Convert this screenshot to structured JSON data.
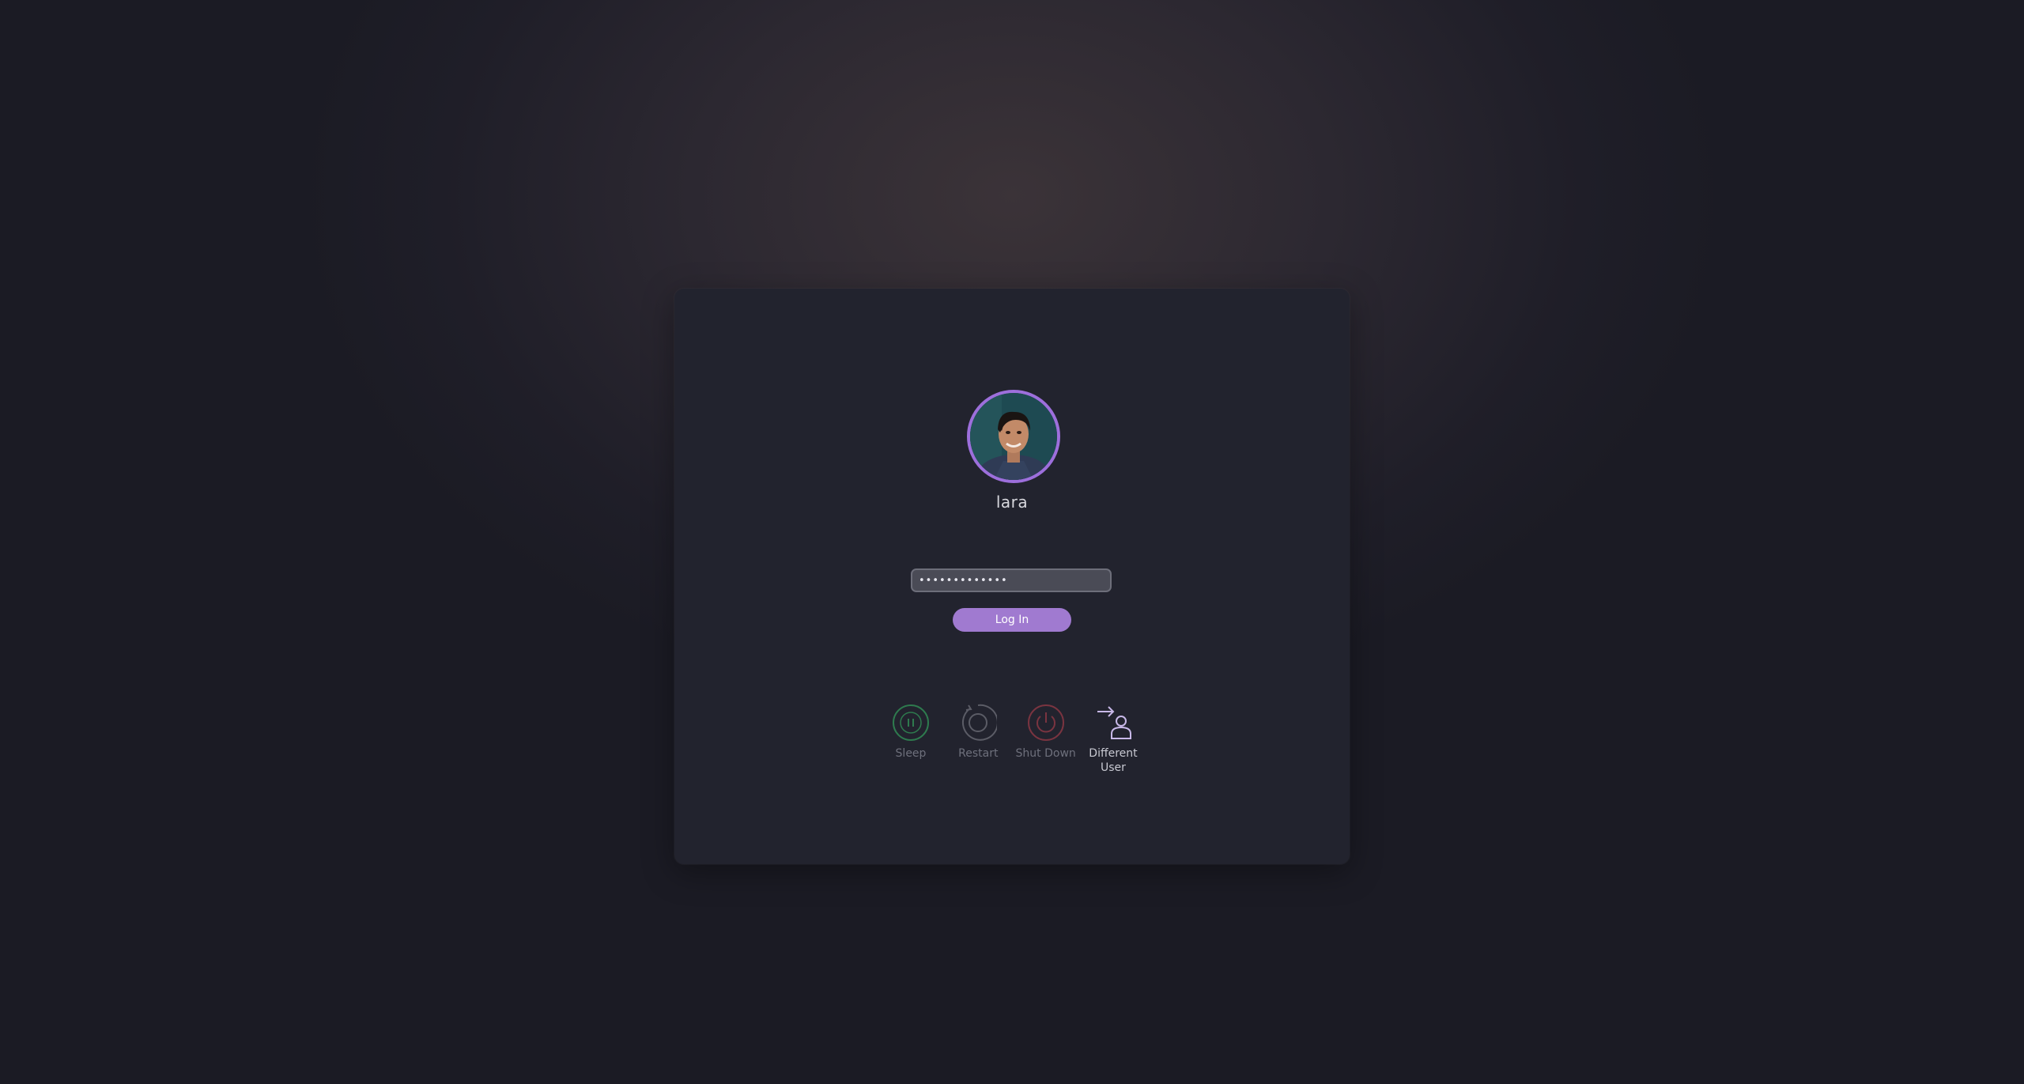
{
  "user": {
    "name": "lara"
  },
  "login": {
    "password_masked": "●●●●●●●●●●●●●",
    "button_label": "Log In"
  },
  "actions": [
    {
      "label": "Sleep",
      "icon": "sleep-icon",
      "color": "#2e7a4e"
    },
    {
      "label": "Restart",
      "icon": "restart-icon",
      "color": "#5b5c66"
    },
    {
      "label": "Shut Down",
      "icon": "power-icon",
      "color": "#7a3440"
    },
    {
      "label": "Different User",
      "icon": "switch-user-icon",
      "color": "#c8b8e8"
    }
  ],
  "colors": {
    "accent": "#a07ad0",
    "avatar_ring": "#9d6fdc",
    "card": "#22232e"
  }
}
